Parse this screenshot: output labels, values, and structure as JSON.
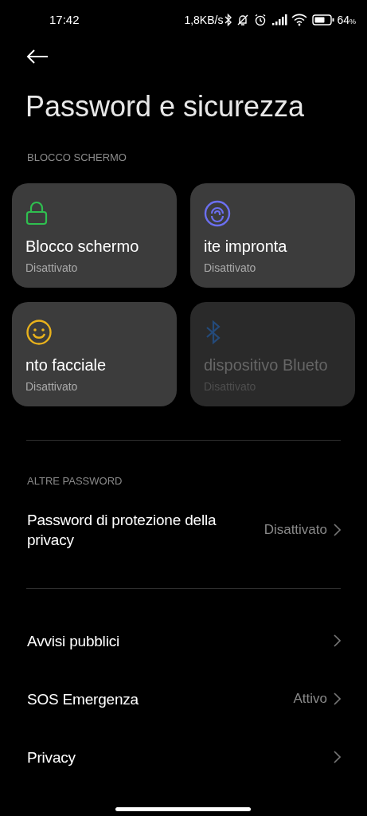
{
  "status_bar": {
    "time": "17:42",
    "speed": "1,8KB/s",
    "battery": "64",
    "battery_unit": "%"
  },
  "title": "Password e sicurezza",
  "screen_lock_section": {
    "header": "BLOCCO SCHERMO",
    "tiles": [
      {
        "kind": "lock",
        "title": "Blocco schermo",
        "subtitle": "Disattivato",
        "disabled": false
      },
      {
        "kind": "fingerprint",
        "title": "ite impronta",
        "subtitle": "Disattivato",
        "disabled": false
      },
      {
        "kind": "face",
        "title": "nto facciale",
        "subtitle": "Disattivato",
        "disabled": false
      },
      {
        "kind": "bluetooth",
        "title": "dispositivo Blueto",
        "subtitle": "Disattivato",
        "disabled": true
      }
    ]
  },
  "other_passwords": {
    "header": "ALTRE PASSWORD",
    "items": [
      {
        "label": "Password di protezione della privacy",
        "value": "Disattivato"
      }
    ]
  },
  "items": [
    {
      "label": "Avvisi pubblici"
    },
    {
      "label": "SOS Emergenza",
      "value": "Attivo"
    },
    {
      "label": "Privacy"
    }
  ]
}
